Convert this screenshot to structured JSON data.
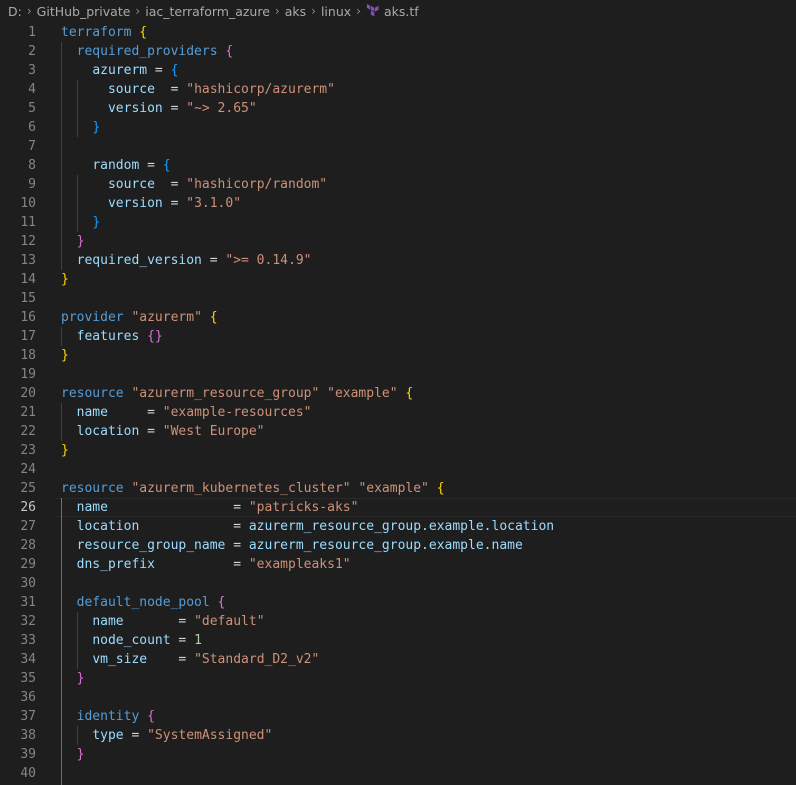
{
  "breadcrumb": {
    "items": [
      "D:",
      "GitHub_private",
      "iac_terraform_azure",
      "aks",
      "linux"
    ],
    "file": "aks.tf"
  },
  "editor": {
    "active_line": 26,
    "lines": [
      [
        [
          "terraform",
          "kw"
        ],
        [
          " ",
          ""
        ],
        [
          "{",
          "b1"
        ]
      ],
      [
        [
          "  ",
          ""
        ],
        [
          "required_providers",
          "kw"
        ],
        [
          " ",
          ""
        ],
        [
          "{",
          "b2"
        ]
      ],
      [
        [
          "    ",
          ""
        ],
        [
          "azurerm",
          "id"
        ],
        [
          " = ",
          "op"
        ],
        [
          "{",
          "b3"
        ]
      ],
      [
        [
          "      ",
          ""
        ],
        [
          "source",
          "id"
        ],
        [
          "  = ",
          "op"
        ],
        [
          "\"hashicorp/azurerm\"",
          "str"
        ]
      ],
      [
        [
          "      ",
          ""
        ],
        [
          "version",
          "id"
        ],
        [
          " = ",
          "op"
        ],
        [
          "\"~> 2.65\"",
          "str"
        ]
      ],
      [
        [
          "    ",
          ""
        ],
        [
          "}",
          "b3"
        ]
      ],
      [],
      [
        [
          "    ",
          ""
        ],
        [
          "random",
          "id"
        ],
        [
          " = ",
          "op"
        ],
        [
          "{",
          "b3"
        ]
      ],
      [
        [
          "      ",
          ""
        ],
        [
          "source",
          "id"
        ],
        [
          "  = ",
          "op"
        ],
        [
          "\"hashicorp/random\"",
          "str"
        ]
      ],
      [
        [
          "      ",
          ""
        ],
        [
          "version",
          "id"
        ],
        [
          " = ",
          "op"
        ],
        [
          "\"3.1.0\"",
          "str"
        ]
      ],
      [
        [
          "    ",
          ""
        ],
        [
          "}",
          "b3"
        ]
      ],
      [
        [
          "  ",
          ""
        ],
        [
          "}",
          "b2"
        ]
      ],
      [
        [
          "  ",
          ""
        ],
        [
          "required_version",
          "id"
        ],
        [
          " = ",
          "op"
        ],
        [
          "\">= 0.14.9\"",
          "str"
        ]
      ],
      [
        [
          "}",
          "b1"
        ]
      ],
      [],
      [
        [
          "provider",
          "kw"
        ],
        [
          " ",
          ""
        ],
        [
          "\"azurerm\"",
          "str"
        ],
        [
          " ",
          ""
        ],
        [
          "{",
          "b1"
        ]
      ],
      [
        [
          "  ",
          ""
        ],
        [
          "features",
          "id"
        ],
        [
          " ",
          ""
        ],
        [
          "{}",
          "b2"
        ]
      ],
      [
        [
          "}",
          "b1"
        ]
      ],
      [],
      [
        [
          "resource",
          "kw"
        ],
        [
          " ",
          ""
        ],
        [
          "\"azurerm_resource_group\"",
          "str"
        ],
        [
          " ",
          ""
        ],
        [
          "\"example\"",
          "str"
        ],
        [
          " ",
          ""
        ],
        [
          "{",
          "b1"
        ]
      ],
      [
        [
          "  ",
          ""
        ],
        [
          "name",
          "id"
        ],
        [
          "     = ",
          "op"
        ],
        [
          "\"example-resources\"",
          "str"
        ]
      ],
      [
        [
          "  ",
          ""
        ],
        [
          "location",
          "id"
        ],
        [
          " = ",
          "op"
        ],
        [
          "\"West Europe\"",
          "str"
        ]
      ],
      [
        [
          "}",
          "b1"
        ]
      ],
      [],
      [
        [
          "resource",
          "kw"
        ],
        [
          " ",
          ""
        ],
        [
          "\"azurerm_kubernetes_cluster\"",
          "str"
        ],
        [
          " ",
          ""
        ],
        [
          "\"example\"",
          "str"
        ],
        [
          " ",
          ""
        ],
        [
          "{",
          "b1"
        ]
      ],
      [
        [
          "  ",
          ""
        ],
        [
          "name",
          "id"
        ],
        [
          "                = ",
          "op"
        ],
        [
          "\"patricks-aks\"",
          "str"
        ]
      ],
      [
        [
          "  ",
          ""
        ],
        [
          "location",
          "id"
        ],
        [
          "            = ",
          "op"
        ],
        [
          "azurerm_resource_group.example.location",
          "id"
        ]
      ],
      [
        [
          "  ",
          ""
        ],
        [
          "resource_group_name",
          "id"
        ],
        [
          " = ",
          "op"
        ],
        [
          "azurerm_resource_group.example.name",
          "id"
        ]
      ],
      [
        [
          "  ",
          ""
        ],
        [
          "dns_prefix",
          "id"
        ],
        [
          "          = ",
          "op"
        ],
        [
          "\"exampleaks1\"",
          "str"
        ]
      ],
      [],
      [
        [
          "  ",
          ""
        ],
        [
          "default_node_pool",
          "kw"
        ],
        [
          " ",
          ""
        ],
        [
          "{",
          "b2"
        ]
      ],
      [
        [
          "    ",
          ""
        ],
        [
          "name",
          "id"
        ],
        [
          "       = ",
          "op"
        ],
        [
          "\"default\"",
          "str"
        ]
      ],
      [
        [
          "    ",
          ""
        ],
        [
          "node_count",
          "id"
        ],
        [
          " = ",
          "op"
        ],
        [
          "1",
          "num"
        ]
      ],
      [
        [
          "    ",
          ""
        ],
        [
          "vm_size",
          "id"
        ],
        [
          "    = ",
          "op"
        ],
        [
          "\"Standard_D2_v2\"",
          "str"
        ]
      ],
      [
        [
          "  ",
          ""
        ],
        [
          "}",
          "b2"
        ]
      ],
      [],
      [
        [
          "  ",
          ""
        ],
        [
          "identity",
          "kw"
        ],
        [
          " ",
          ""
        ],
        [
          "{",
          "b2"
        ]
      ],
      [
        [
          "    ",
          ""
        ],
        [
          "type",
          "id"
        ],
        [
          " = ",
          "op"
        ],
        [
          "\"SystemAssigned\"",
          "str"
        ]
      ],
      [
        [
          "  ",
          ""
        ],
        [
          "}",
          "b2"
        ]
      ],
      []
    ]
  },
  "colors": {
    "background": "#1e1e1e",
    "keyword": "#569cd6",
    "identifier": "#9cdcfe",
    "string": "#ce9178",
    "number": "#b5cea8",
    "bracket_1": "#ffd700",
    "bracket_2": "#da70d6",
    "bracket_3": "#179fff"
  }
}
